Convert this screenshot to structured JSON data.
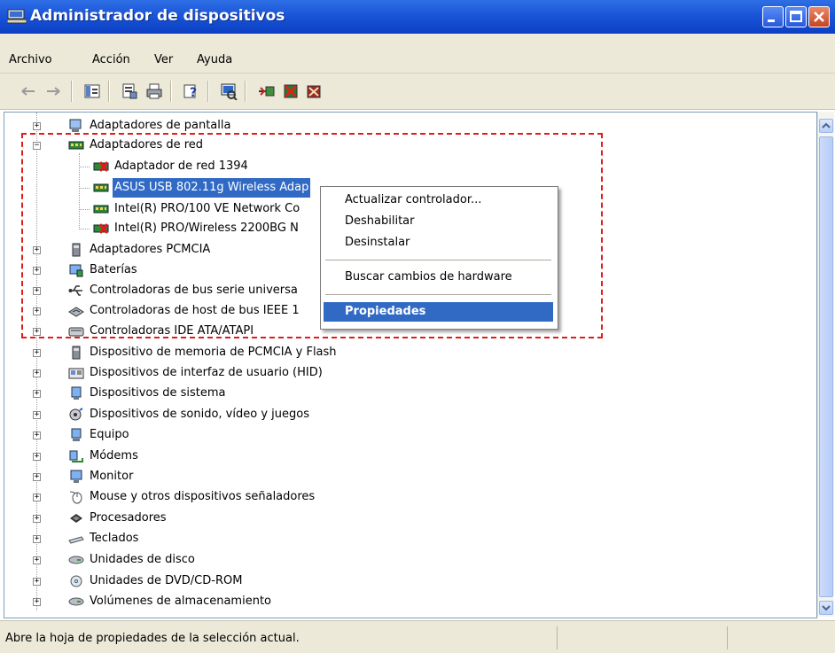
{
  "window": {
    "title": "Administrador de dispositivos"
  },
  "menu": [
    "Archivo",
    "Acción",
    "Ver",
    "Ayuda"
  ],
  "toolbar": {
    "icons": [
      "back-arrow-icon",
      "forward-arrow-icon",
      "console-tree-icon",
      "properties-icon",
      "print-icon",
      "help-icon",
      "scan-hardware-icon",
      "update-driver-icon",
      "disable-device-icon",
      "uninstall-device-icon"
    ]
  },
  "tree": {
    "items": [
      {
        "label": "Adaptadores de pantalla",
        "level": 0,
        "expander": "+"
      },
      {
        "label": "Adaptadores de red",
        "level": 0,
        "expander": "−"
      },
      {
        "label": "Adaptador de red 1394",
        "level": 1
      },
      {
        "label": "ASUS USB 802.11g Wireless Adap",
        "level": 1,
        "selected": true
      },
      {
        "label": "Intel(R) PRO/100 VE Network Co",
        "level": 1
      },
      {
        "label": "Intel(R) PRO/Wireless 2200BG N",
        "level": 1
      },
      {
        "label": "Adaptadores PCMCIA",
        "level": 0,
        "expander": "+"
      },
      {
        "label": "Baterías",
        "level": 0,
        "expander": "+"
      },
      {
        "label": "Controladoras de bus serie universa",
        "level": 0,
        "expander": "+"
      },
      {
        "label": "Controladoras de host de bus IEEE 1",
        "level": 0,
        "expander": "+"
      },
      {
        "label": "Controladoras IDE ATA/ATAPI",
        "level": 0,
        "expander": "+"
      },
      {
        "label": "Dispositivo de memoria de PCMCIA y Flash",
        "level": 0,
        "expander": "+"
      },
      {
        "label": "Dispositivos de interfaz de usuario (HID)",
        "level": 0,
        "expander": "+"
      },
      {
        "label": "Dispositivos de sistema",
        "level": 0,
        "expander": "+"
      },
      {
        "label": "Dispositivos de sonido, vídeo y juegos",
        "level": 0,
        "expander": "+"
      },
      {
        "label": "Equipo",
        "level": 0,
        "expander": "+"
      },
      {
        "label": "Módems",
        "level": 0,
        "expander": "+"
      },
      {
        "label": "Monitor",
        "level": 0,
        "expander": "+"
      },
      {
        "label": "Mouse y otros dispositivos señaladores",
        "level": 0,
        "expander": "+"
      },
      {
        "label": "Procesadores",
        "level": 0,
        "expander": "+"
      },
      {
        "label": "Teclados",
        "level": 0,
        "expander": "+"
      },
      {
        "label": "Unidades de disco",
        "level": 0,
        "expander": "+"
      },
      {
        "label": "Unidades de DVD/CD-ROM",
        "level": 0,
        "expander": "+"
      },
      {
        "label": "Volúmenes de almacenamiento",
        "level": 0,
        "expander": "+"
      }
    ]
  },
  "context_menu": {
    "update_driver": "Actualizar controlador...",
    "disable": "Deshabilitar",
    "uninstall": "Desinstalar",
    "scan": "Buscar cambios de hardware",
    "properties": "Propiedades"
  },
  "status": {
    "text": "Abre la hoja de propiedades de la selección actual."
  },
  "colors": {
    "titlebar": "#1a55d8",
    "selection": "#316ac5",
    "highlight_box": "#e21b1b",
    "chrome": "#ece9d8"
  }
}
